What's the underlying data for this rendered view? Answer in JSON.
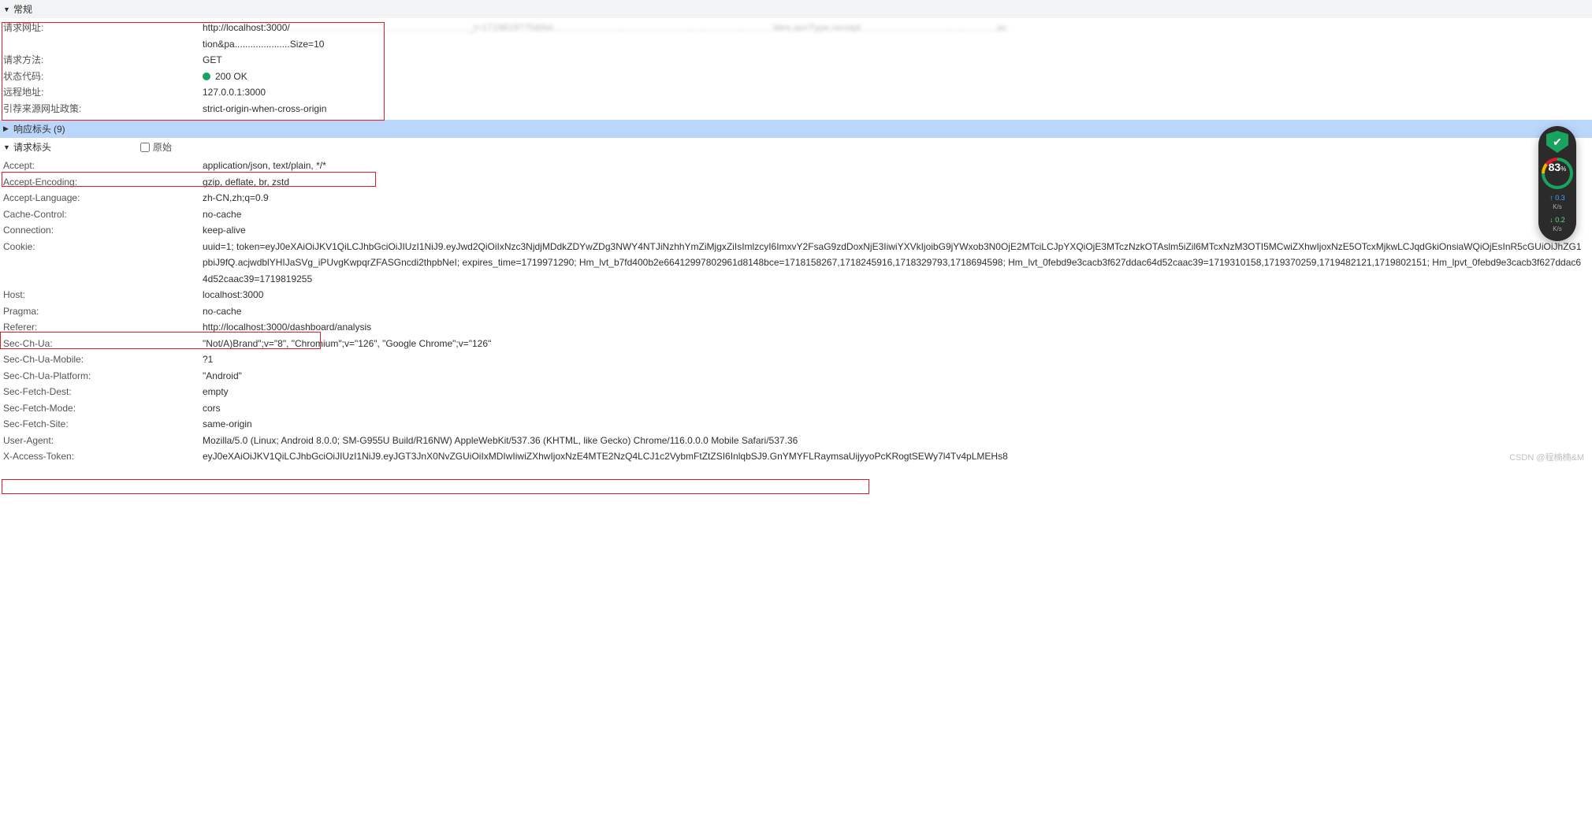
{
  "sections": {
    "general": {
      "title": "常规"
    },
    "response": {
      "title": "响应标头",
      "count": "(9)"
    },
    "request": {
      "title": "请求标头",
      "raw_label": "原始"
    }
  },
  "general": {
    "request_url": {
      "label": "请求网址:",
      "value_line1": "http://localhost:3000/",
      "value_blur": "...................................................................._t=1719819775&fiel..........................,........................,.....,............,.............bles,asnType,receipt..................................,...,............,ac",
      "value_line2": "tion&pa.....................Size=10"
    },
    "request_method": {
      "label": "请求方法:",
      "value": "GET"
    },
    "status_code": {
      "label": "状态代码:",
      "value": "200 OK"
    },
    "remote_address": {
      "label": "远程地址:",
      "value": "127.0.0.1:3000"
    },
    "referrer_policy": {
      "label": "引荐来源网址政策:",
      "value": "strict-origin-when-cross-origin"
    }
  },
  "request_headers": [
    {
      "label": "Accept:",
      "value": "application/json, text/plain, */*"
    },
    {
      "label": "Accept-Encoding:",
      "value": "gzip, deflate, br, zstd"
    },
    {
      "label": "Accept-Language:",
      "value": "zh-CN,zh;q=0.9"
    },
    {
      "label": "Cache-Control:",
      "value": "no-cache"
    },
    {
      "label": "Connection:",
      "value": "keep-alive"
    },
    {
      "label": "Cookie:",
      "value": "uuid=1; token=eyJ0eXAiOiJKV1QiLCJhbGciOiJIUzI1NiJ9.eyJwd2QiOiIxNzc3NjdjMDdkZDYwZDg3NWY4NTJiNzhhYmZiMjgxZiIsImlzcyI6ImxvY2FsaG9zdDoxNjE3IiwiYXVkIjoibG9jYWxob3N0OjE2MTciLCJpYXQiOjE3MTczNzkOTAslm5iZil6MTcxNzM3OTI5MCwiZXhwIjoxNzE5OTcxMjkwLCJqdGkiOnsiaWQiOjEsInR5cGUiOiJhZG1pbiJ9fQ.acjwdblYHIJaSVg_iPUvgKwpqrZFASGncdi2thpbNeI; expires_time=1719971290; Hm_lvt_b7fd400b2e66412997802961d8148bce=1718158267,1718245916,1718329793,1718694598; Hm_lvt_0febd9e3cacb3f627ddac64d52caac39=1719310158,1719370259,1719482121,1719802151; Hm_lpvt_0febd9e3cacb3f627ddac64d52caac39=1719819255"
    },
    {
      "label": "Host:",
      "value": "localhost:3000"
    },
    {
      "label": "Pragma:",
      "value": "no-cache"
    },
    {
      "label": "Referer:",
      "value": "http://localhost:3000/dashboard/analysis"
    },
    {
      "label": "Sec-Ch-Ua:",
      "value": "\"Not/A)Brand\";v=\"8\", \"Chromium\";v=\"126\", \"Google Chrome\";v=\"126\""
    },
    {
      "label": "Sec-Ch-Ua-Mobile:",
      "value": "?1"
    },
    {
      "label": "Sec-Ch-Ua-Platform:",
      "value": "\"Android\""
    },
    {
      "label": "Sec-Fetch-Dest:",
      "value": "empty"
    },
    {
      "label": "Sec-Fetch-Mode:",
      "value": "cors"
    },
    {
      "label": "Sec-Fetch-Site:",
      "value": "same-origin"
    },
    {
      "label": "User-Agent:",
      "value": "Mozilla/5.0 (Linux; Android 8.0.0; SM-G955U Build/R16NW) AppleWebKit/537.36 (KHTML, like Gecko) Chrome/116.0.0.0 Mobile Safari/537.36"
    },
    {
      "label": "X-Access-Token:",
      "value": "eyJ0eXAiOiJKV1QiLCJhbGciOiJIUzI1NiJ9.eyJGT3JnX0NvZGUiOiIxMDIwIiwiZXhwIjoxNzE4MTE2NzQ4LCJ1c2VybmFtZtZSI6InlqbSJ9.GnYMYFLRaymsaUijyyoPcKRogtSEWy7l4Tv4pLMEHs8"
    }
  ],
  "widget": {
    "percent": "83",
    "up_speed": "0.3",
    "down_speed": "0.2",
    "unit": "K/s"
  },
  "watermark": "CSDN @程楠楠&M"
}
